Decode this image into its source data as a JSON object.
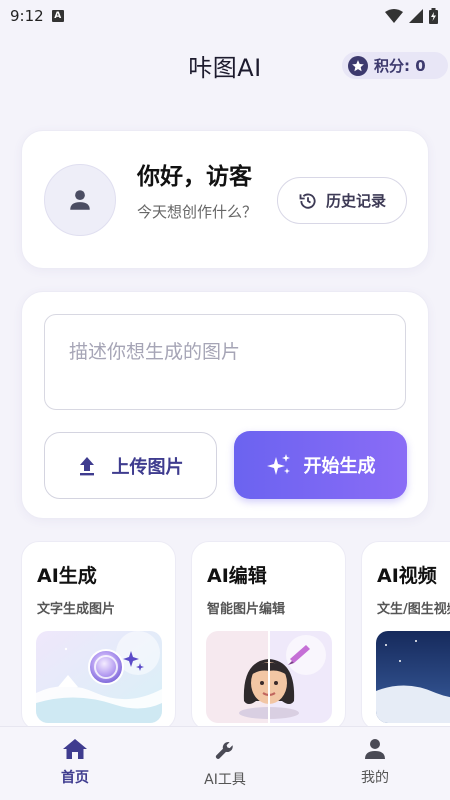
{
  "status_bar": {
    "time": "9:12",
    "notification_letter": "A"
  },
  "header": {
    "title": "咔图AI",
    "points_label": "积分: 0"
  },
  "welcome": {
    "greeting": "你好，访客",
    "subtitle": "今天想创作什么？",
    "history_button": "历史记录"
  },
  "prompt": {
    "placeholder": "描述你想生成的图片",
    "upload_button": "上传图片",
    "generate_button": "开始生成"
  },
  "tools": [
    {
      "title": "AI生成",
      "subtitle": "文字生成图片"
    },
    {
      "title": "AI编辑",
      "subtitle": "智能图片编辑"
    },
    {
      "title": "AI视频",
      "subtitle": "文生/图生视频"
    }
  ],
  "nav": {
    "items": [
      {
        "label": "首页",
        "icon": "home-icon",
        "active": true
      },
      {
        "label": "AI工具",
        "icon": "wrench-icon",
        "active": false
      },
      {
        "label": "我的",
        "icon": "person-icon",
        "active": false
      }
    ]
  },
  "colors": {
    "accent": "#3f3c8f",
    "gradient_start": "#6b63f0",
    "gradient_end": "#8a6cf6",
    "background": "#f4f3fa"
  }
}
